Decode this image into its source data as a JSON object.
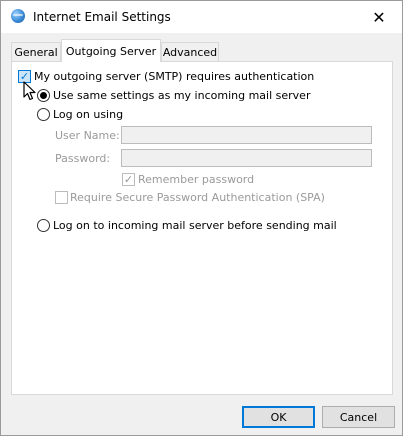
{
  "window": {
    "title": "Internet Email Settings",
    "close_glyph": "✕",
    "app_icon": "globe-icon"
  },
  "tabs": [
    {
      "label": "General",
      "active": false
    },
    {
      "label": "Outgoing Server",
      "active": true
    },
    {
      "label": "Advanced",
      "active": false
    }
  ],
  "outgoing": {
    "requires_auth_label": "My outgoing server (SMTP) requires authentication",
    "requires_auth_checked": true,
    "use_same_label": "Use same settings as my incoming mail server",
    "log_on_using_label": "Log on using",
    "user_name_label": "User Name:",
    "user_name_value": "",
    "password_label": "Password:",
    "password_value": "",
    "remember_password_label": "Remember password",
    "remember_password_checked": true,
    "spa_label": "Require Secure Password Authentication (SPA)",
    "spa_checked": false,
    "log_on_incoming_label": "Log on to incoming mail server before sending mail",
    "selected_option": "use_same"
  },
  "buttons": {
    "ok_label": "OK",
    "cancel_label": "Cancel"
  },
  "colors": {
    "accent": "#0078d7",
    "disabled_text": "#9a9a9a"
  }
}
